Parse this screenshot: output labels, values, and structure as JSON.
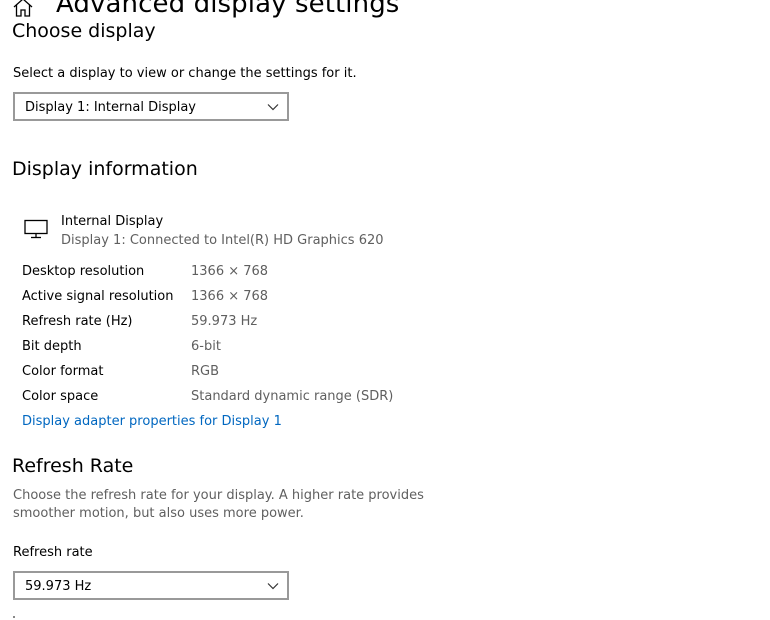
{
  "header": {
    "title": "Advanced display settings",
    "home_icon": "home-icon"
  },
  "choose_display": {
    "heading": "Choose display",
    "description": "Select a display to view or change the settings for it.",
    "selected": "Display 1: Internal Display"
  },
  "display_info": {
    "heading": "Display information",
    "monitor_icon": "monitor-icon",
    "display_name": "Internal Display",
    "connection": "Display 1: Connected to Intel(R) HD Graphics 620",
    "rows": [
      {
        "label": "Desktop resolution",
        "value": "1366 × 768"
      },
      {
        "label": "Active signal resolution",
        "value": "1366 × 768"
      },
      {
        "label": "Refresh rate (Hz)",
        "value": "59.973 Hz"
      },
      {
        "label": "Bit depth",
        "value": "6-bit"
      },
      {
        "label": "Color format",
        "value": "RGB"
      },
      {
        "label": "Color space",
        "value": "Standard dynamic range (SDR)"
      }
    ],
    "adapter_link": "Display adapter properties for Display 1"
  },
  "refresh_rate": {
    "heading": "Refresh Rate",
    "description_line1": "Choose the refresh rate for your display. A higher rate provides",
    "description_line2": "smoother motion, but also uses more power.",
    "label": "Refresh rate",
    "selected": "59.973 Hz"
  },
  "colors": {
    "link": "#0067c0",
    "secondary_text": "#5f5f5f",
    "dropdown_border": "#999999"
  }
}
